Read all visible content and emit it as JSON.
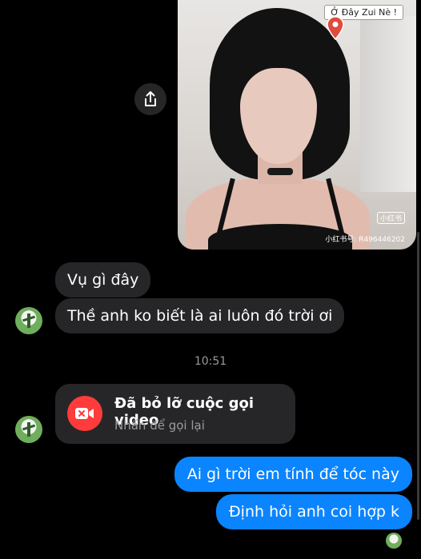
{
  "photo": {
    "tag": "Ở Đây Zui Nè !",
    "watermark_logo": "小红书",
    "watermark_id": "小红书号: R496446202"
  },
  "messages": {
    "incoming_1": "Vụ gì đây",
    "incoming_2": "Thề anh ko biết là ai luôn đó trời ơi",
    "timestamp": "10:51",
    "missed_call_title": "Đã bỏ lỡ cuộc gọi video",
    "missed_call_sub": "Nhấn để gọi lại",
    "outgoing_1": "Ai gì trời em tính để tóc này",
    "outgoing_2": "Định hỏi anh coi hợp k"
  },
  "colors": {
    "background": "#000000",
    "incoming_bubble": "#262628",
    "outgoing_bubble": "#0b84ff",
    "missed_call_icon": "#ff3b3b"
  },
  "icons": {
    "share": "share-icon",
    "location": "location-pin-icon",
    "video_missed": "video-call-missed-icon"
  }
}
